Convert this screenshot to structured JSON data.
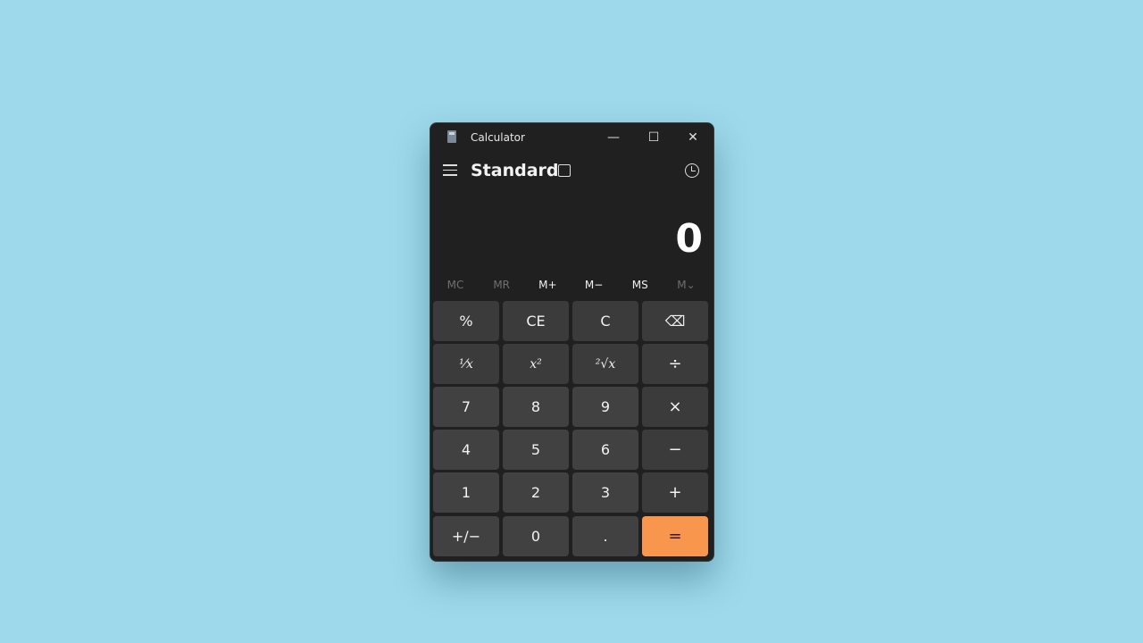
{
  "window": {
    "title": "Calculator",
    "minimize": "—",
    "maximize": "☐",
    "close": "✕"
  },
  "header": {
    "mode": "Standard"
  },
  "display": {
    "value": "0"
  },
  "memory": [
    {
      "label": "MC",
      "enabled": false
    },
    {
      "label": "MR",
      "enabled": false
    },
    {
      "label": "M+",
      "enabled": true
    },
    {
      "label": "M−",
      "enabled": true
    },
    {
      "label": "MS",
      "enabled": true
    },
    {
      "label": "M⌄",
      "enabled": false
    }
  ],
  "keys": [
    [
      "%",
      "CE",
      "C",
      "⌫"
    ],
    [
      "¹⁄x",
      "x²",
      "²√x",
      "÷"
    ],
    [
      "7",
      "8",
      "9",
      "×"
    ],
    [
      "4",
      "5",
      "6",
      "−"
    ],
    [
      "1",
      "2",
      "3",
      "+"
    ],
    [
      "+/−",
      "0",
      ".",
      "="
    ]
  ],
  "colors": {
    "accent": "#f8964d",
    "background": "#9dd9ea",
    "window": "#202020"
  }
}
